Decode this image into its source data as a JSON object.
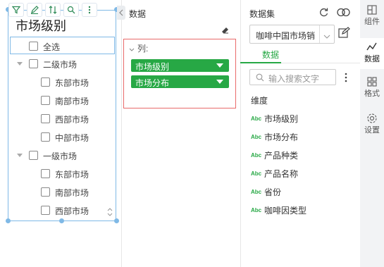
{
  "widget": {
    "title": "市场级别",
    "select_all": "全选",
    "groups": [
      {
        "label": "二级市场",
        "items": [
          "东部市场",
          "南部市场",
          "西部市场",
          "中部市场"
        ]
      },
      {
        "label": "一级市场",
        "items": [
          "东部市场",
          "南部市场",
          "西部市场"
        ]
      }
    ]
  },
  "middle": {
    "title": "数据",
    "column_label": "列:",
    "fields": [
      "市场级别",
      "市场分布"
    ]
  },
  "dataset": {
    "title": "数据集",
    "selected": "咖啡中国市场销",
    "tab": "数据",
    "search_placeholder": "输入搜索文字",
    "dimension_label": "维度",
    "field_type": "Abc",
    "fields": [
      "市场级别",
      "市场分布",
      "产品种类",
      "产品名称",
      "省份",
      "咖啡因类型"
    ]
  },
  "sidebar": {
    "items": [
      {
        "label": "组件",
        "icon": "component-icon"
      },
      {
        "label": "数据",
        "icon": "data-chart-icon"
      },
      {
        "label": "格式",
        "icon": "format-grid-icon"
      },
      {
        "label": "设置",
        "icon": "settings-gear-icon"
      }
    ]
  },
  "colors": {
    "accent": "#27a845",
    "selection": "#7fb9e6",
    "highlight_border": "#e96a6a"
  }
}
